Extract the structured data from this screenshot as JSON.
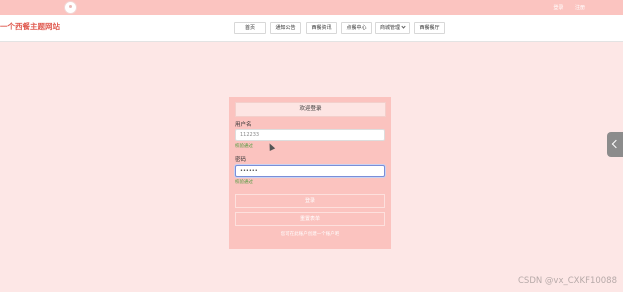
{
  "topbar": {
    "links": [
      "登录",
      "注册"
    ]
  },
  "header": {
    "site_title": "一个西餐主题网站",
    "nav": [
      {
        "label": "首页"
      },
      {
        "label": "通知公告"
      },
      {
        "label": "西餐资讯"
      },
      {
        "label": "点餐中心"
      },
      {
        "label": "商城管理"
      },
      {
        "label": "西餐餐厅"
      }
    ]
  },
  "login": {
    "title": "欢迎登录",
    "username_label": "用户名",
    "username_value": "112233",
    "username_hint": "校验通过",
    "password_label": "密码",
    "password_value": "••••••",
    "password_hint": "校验通过",
    "login_button": "登录",
    "reset_button": "重置表单",
    "register_link": "您可在此账户创建一个账户吧"
  },
  "watermark": "CSDN @vx_CXKF10088"
}
